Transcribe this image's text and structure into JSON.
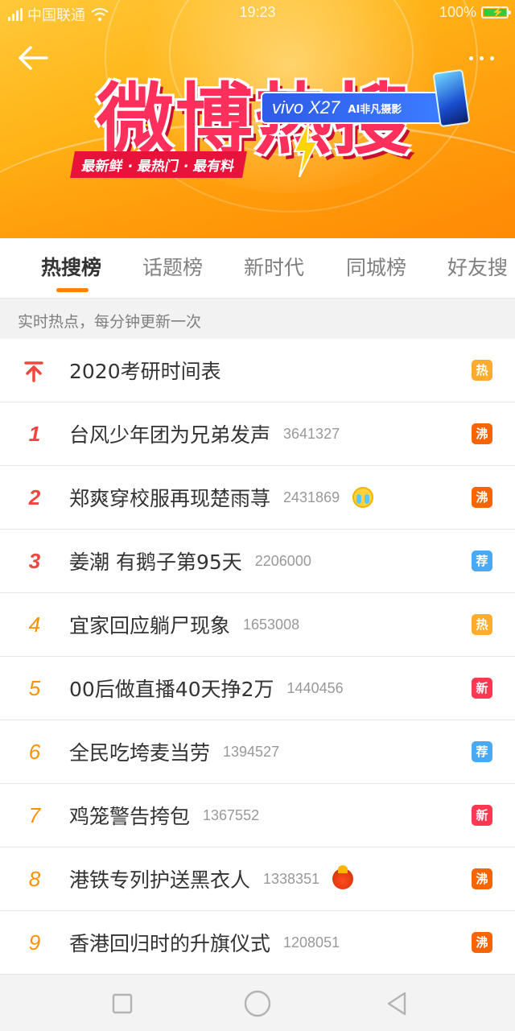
{
  "status_bar": {
    "carrier": "中国联通",
    "time": "19:23",
    "battery": "100%"
  },
  "banner": {
    "title": "微博热搜",
    "tagline": "最新鲜 · 最热门 · 最有料",
    "sponsor_brand": "vivo X27",
    "sponsor_slogan": "AI非凡摄影"
  },
  "tabs": [
    {
      "label": "热搜榜",
      "active": true
    },
    {
      "label": "话题榜",
      "active": false
    },
    {
      "label": "新时代",
      "active": false
    },
    {
      "label": "同城榜",
      "active": false
    },
    {
      "label": "好友搜",
      "active": false
    }
  ],
  "hint": "实时热点，每分钟更新一次",
  "accent_color": "#ff8200",
  "badge_colors": {
    "热": "#ffab2d",
    "沸": "#f86400",
    "荐": "#4aa9f5",
    "新": "#ff3852"
  },
  "list": [
    {
      "rank": "",
      "pinned": true,
      "title": "2020考研时间表",
      "count": "",
      "badge": "热",
      "emoji": ""
    },
    {
      "rank": "1",
      "title": "台风少年团为兄弟发声",
      "count": "3641327",
      "badge": "沸",
      "emoji": ""
    },
    {
      "rank": "2",
      "title": "郑爽穿校服再现楚雨荨",
      "count": "2431869",
      "badge": "沸",
      "emoji": "crying-face"
    },
    {
      "rank": "3",
      "title": "姜潮 有鹅子第95天",
      "count": "2206000",
      "badge": "荐",
      "emoji": ""
    },
    {
      "rank": "4",
      "title": "宜家回应躺尸现象",
      "count": "1653008",
      "badge": "热",
      "emoji": ""
    },
    {
      "rank": "5",
      "title": "00后做直播40天挣2万",
      "count": "1440456",
      "badge": "新",
      "emoji": ""
    },
    {
      "rank": "6",
      "title": "全民吃垮麦当劳",
      "count": "1394527",
      "badge": "荐",
      "emoji": ""
    },
    {
      "rank": "7",
      "title": "鸡笼警告挎包",
      "count": "1367552",
      "badge": "新",
      "emoji": ""
    },
    {
      "rank": "8",
      "title": "港铁专列护送黑衣人",
      "count": "1338351",
      "badge": "沸",
      "emoji": "angry-face"
    },
    {
      "rank": "9",
      "title": "香港回归时的升旗仪式",
      "count": "1208051",
      "badge": "沸",
      "emoji": ""
    }
  ],
  "nav": {
    "recent": "square-icon",
    "home": "circle-icon",
    "back": "triangle-back-icon"
  }
}
